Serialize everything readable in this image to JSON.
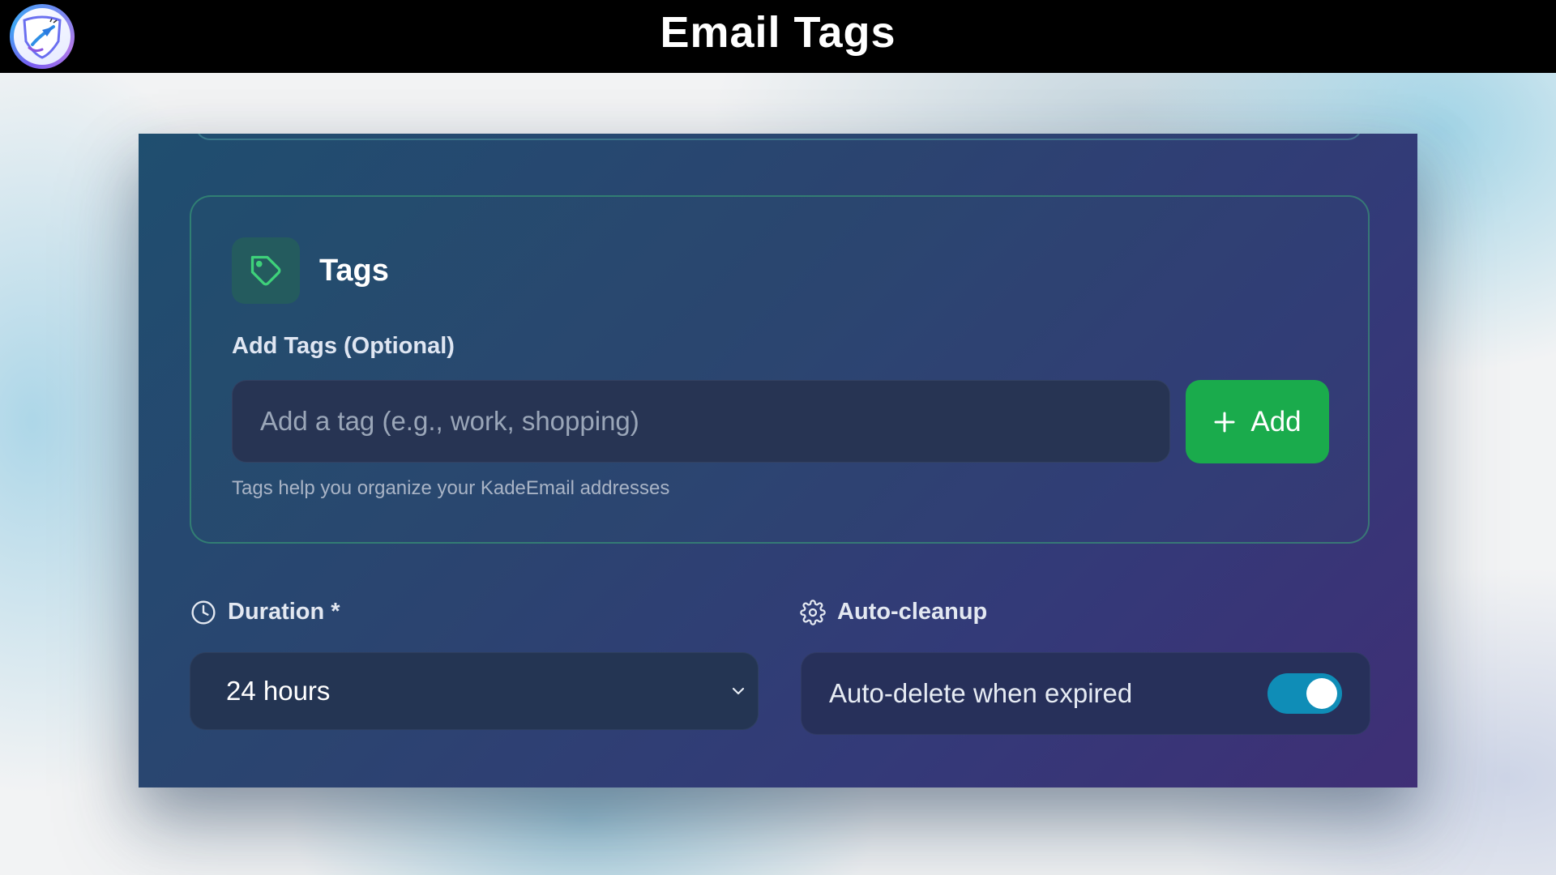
{
  "header": {
    "title": "Email Tags",
    "logo_icon": "kadeemail-logo-icon"
  },
  "tags_panel": {
    "title": "Tags",
    "icon": "tag-icon",
    "field_label": "Add Tags (Optional)",
    "input_placeholder": "Add a tag (e.g., work, shopping)",
    "input_value": "",
    "add_button_label": "Add",
    "helper_text": "Tags help you organize your KadeEmail addresses"
  },
  "duration": {
    "label": "Duration *",
    "selected_value": "24 hours",
    "icon": "clock-icon"
  },
  "auto_cleanup": {
    "label": "Auto-cleanup",
    "icon": "gear-icon",
    "toggle_label": "Auto-delete when expired",
    "toggle_on": true
  },
  "colors": {
    "accent_green": "#1aab4c",
    "toggle_blue": "#0f8db7",
    "card_start": "#1f4e6f",
    "card_end": "#3f2f76"
  }
}
